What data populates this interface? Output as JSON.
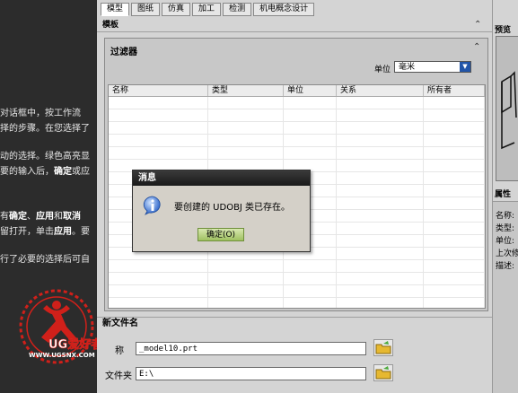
{
  "left_panel": {
    "lines": [
      {
        "segments": [
          {
            "text": "对话框中，按工作流",
            "bold": false
          }
        ]
      },
      {
        "segments": [
          {
            "text": "择的步骤。在您选择了",
            "bold": false
          }
        ]
      },
      {
        "segments": [
          {
            "text": "动的选择。绿色高亮显",
            "bold": false
          }
        ]
      },
      {
        "segments": [
          {
            "text": "要的输入后，",
            "bold": false
          },
          {
            "text": "确定",
            "bold": true
          },
          {
            "text": "或应",
            "bold": false
          }
        ]
      },
      {
        "segments": [
          {
            "text": "有",
            "bold": false
          },
          {
            "text": "确定",
            "bold": true
          },
          {
            "text": "、",
            "bold": false
          },
          {
            "text": "应用",
            "bold": true
          },
          {
            "text": "和",
            "bold": false
          },
          {
            "text": "取消",
            "bold": true
          }
        ]
      },
      {
        "segments": [
          {
            "text": "留打开，单击",
            "bold": false
          },
          {
            "text": "应用",
            "bold": true
          },
          {
            "text": "。要",
            "bold": false
          }
        ]
      },
      {
        "segments": [
          {
            "text": "行了必要的选择后可自",
            "bold": false
          }
        ]
      }
    ],
    "logo": {
      "brand_text": "UG爱好者",
      "url_text": "WWW.UGSNX.COM",
      "color": "#d0201a"
    }
  },
  "tabs": [
    "模型",
    "图纸",
    "仿真",
    "加工",
    "检测",
    "机电概念设计"
  ],
  "active_tab": 0,
  "template_header": "模板",
  "filter": {
    "title": "过滤器",
    "unit_label": "单位",
    "unit_value": "毫米"
  },
  "grid": {
    "columns": [
      "名称",
      "类型",
      "单位",
      "关系",
      "所有者"
    ],
    "row_count": 18
  },
  "new_file": {
    "header": "新文件名",
    "name_label": "称",
    "name_value": "_model10.prt",
    "folder_label": "文件夹",
    "folder_value": "E:\\"
  },
  "right_panel": {
    "preview_title": "预览",
    "properties_title": "属性",
    "properties": [
      "名称:",
      "类型:",
      "单位:",
      "上次修",
      "描述:"
    ]
  },
  "dialog": {
    "title": "消息",
    "message": "要创建的 UDOBJ 类已存在。",
    "ok_label": "确定(O)",
    "icon": "info-icon"
  },
  "colors": {
    "dialog_title_bg": "#1a1a1a",
    "ok_button": "#9fc060",
    "unit_dropdown": "#2255a8",
    "logo": "#d0201a"
  }
}
